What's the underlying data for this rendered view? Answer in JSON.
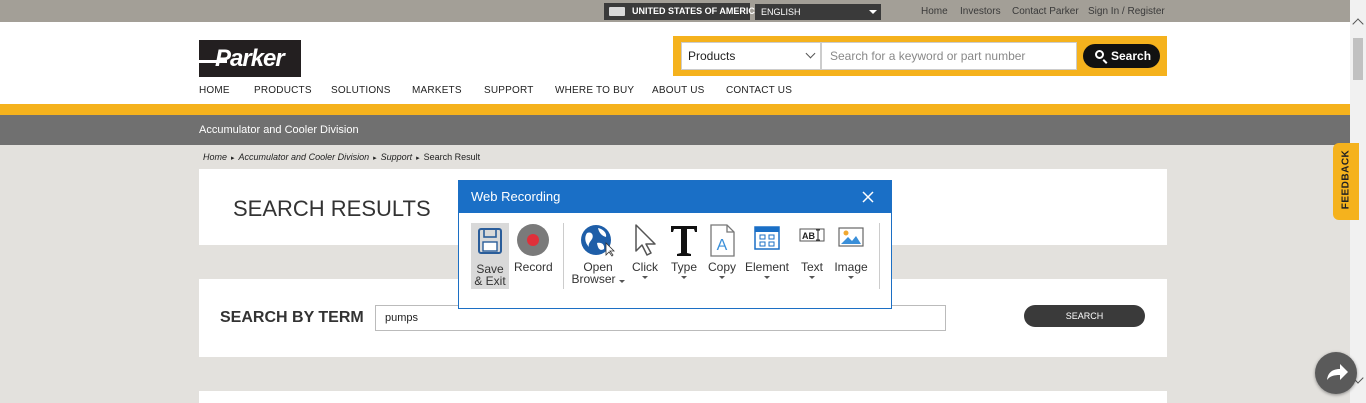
{
  "topbar": {
    "country": "UNITED STATES OF AMERICA",
    "language": "ENGLISH",
    "links": [
      "Home",
      "Investors",
      "Contact Parker",
      "Sign In / Register"
    ]
  },
  "header": {
    "logo": "Parker",
    "search_category": "Products",
    "search_placeholder": "Search for a keyword or part number",
    "search_button": "Search",
    "nav": [
      "HOME",
      "PRODUCTS",
      "SOLUTIONS",
      "MARKETS",
      "SUPPORT",
      "WHERE TO BUY",
      "ABOUT US",
      "CONTACT US"
    ]
  },
  "division": "Accumulator and Cooler Division",
  "breadcrumb": [
    "Home",
    "Accumulator and Cooler Division",
    "Support",
    "Search Result"
  ],
  "main": {
    "results_heading": "SEARCH RESULTS",
    "term_heading": "SEARCH BY TERM",
    "term_value": "pumps",
    "term_button": "SEARCH"
  },
  "feedback": "FEEDBACK",
  "dialog": {
    "title": "Web Recording",
    "tools": {
      "save_line1": "Save",
      "save_line2": "& Exit",
      "record": "Record",
      "open_line1": "Open",
      "open_line2": "Browser",
      "click": "Click",
      "type": "Type",
      "copy": "Copy",
      "element": "Element",
      "text": "Text",
      "image": "Image"
    }
  },
  "colors": {
    "brand_yellow": "#f5b21d",
    "dialog_blue": "#1a6fc6",
    "record_red": "#e0303a"
  }
}
